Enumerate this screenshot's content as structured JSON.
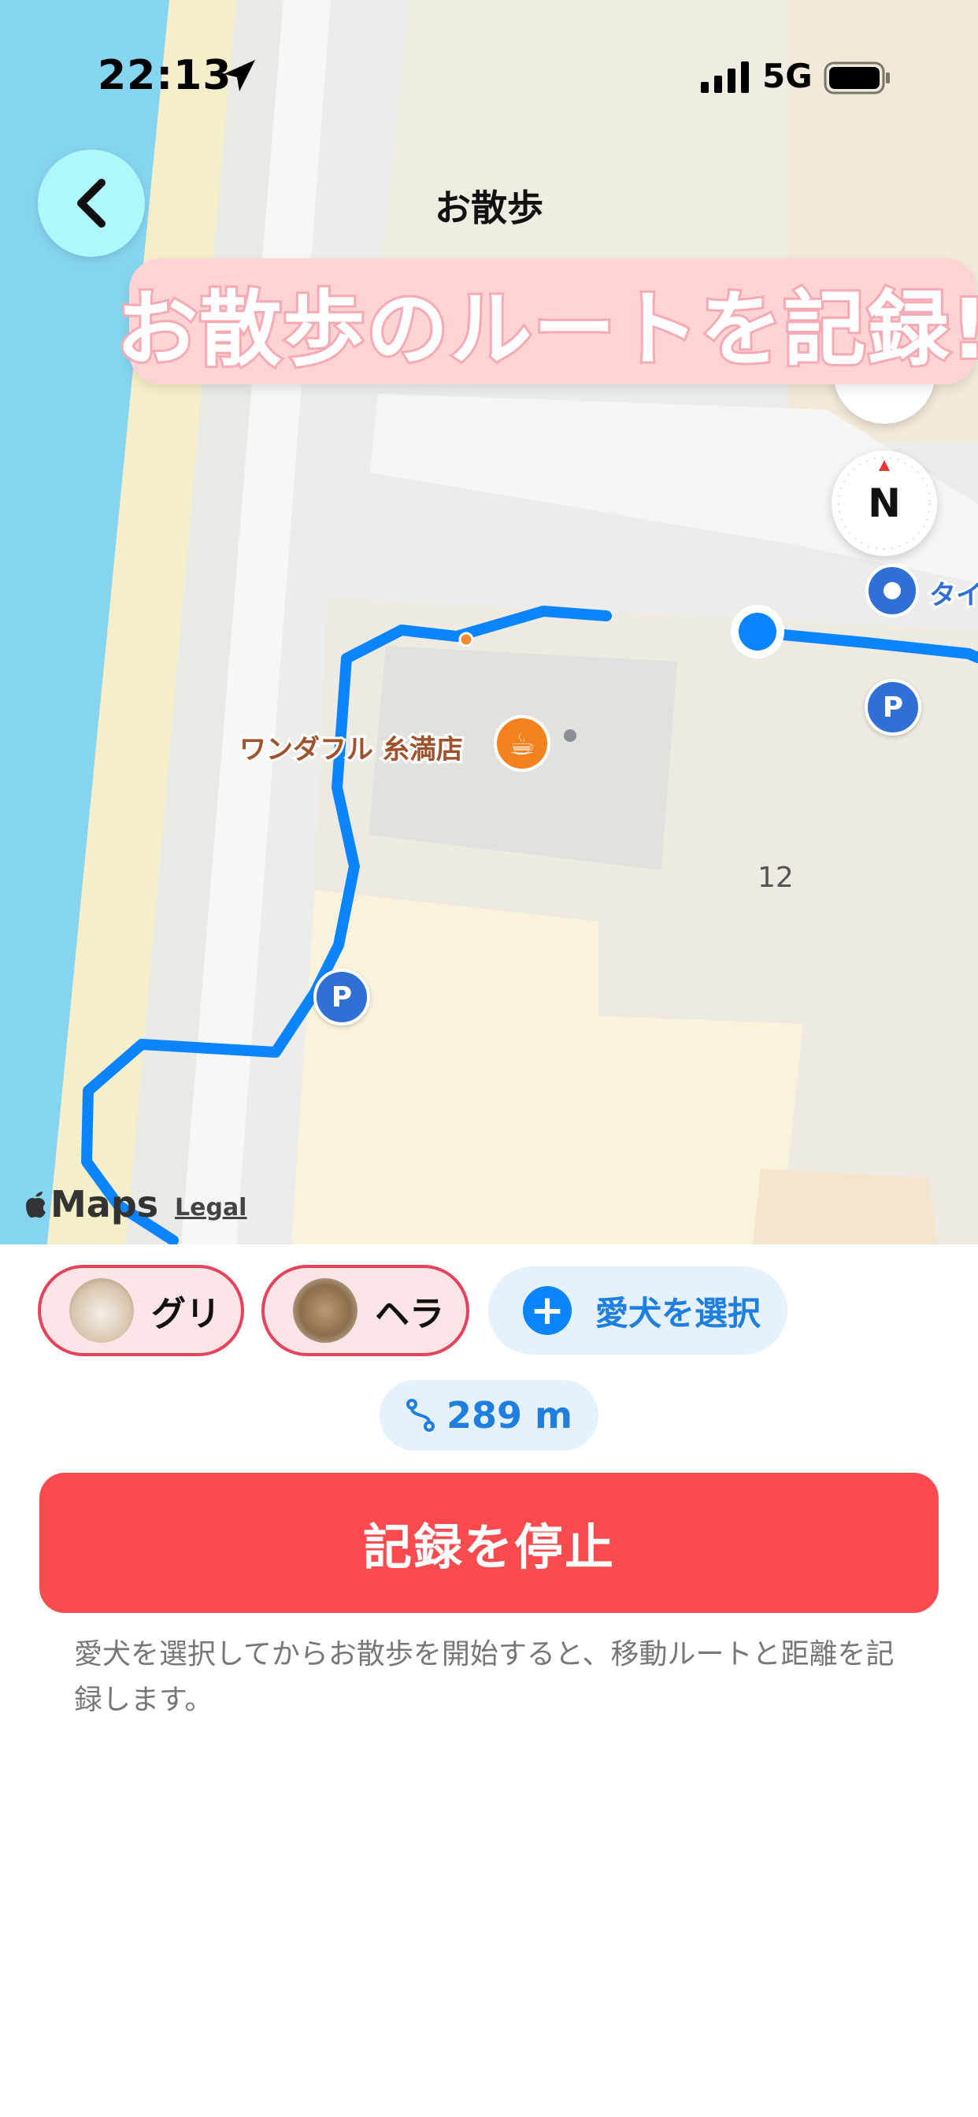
{
  "status_bar": {
    "time": "22:13",
    "network": "5G"
  },
  "nav": {
    "title": "お散歩"
  },
  "banner": {
    "text": "お散歩のルートを記録!"
  },
  "map": {
    "compass_label": "N",
    "poi_name": "ワンダフル 糸満店",
    "parcel_number": "12",
    "poi_partial_label": "タイ",
    "parking_label": "P",
    "brand": "Maps",
    "legal": "Legal",
    "route_color": "#0a84ff"
  },
  "dogs": [
    {
      "name": "グリ",
      "selected": true
    },
    {
      "name": "ヘラ",
      "selected": true
    }
  ],
  "select_dog": {
    "label": "愛犬を選択"
  },
  "distance": {
    "value": "289 m"
  },
  "stop_button": {
    "label": "記録を停止"
  },
  "hint": {
    "text": "愛犬を選択してからお散歩を開始すると、移動ルートと距離を記録します。"
  }
}
